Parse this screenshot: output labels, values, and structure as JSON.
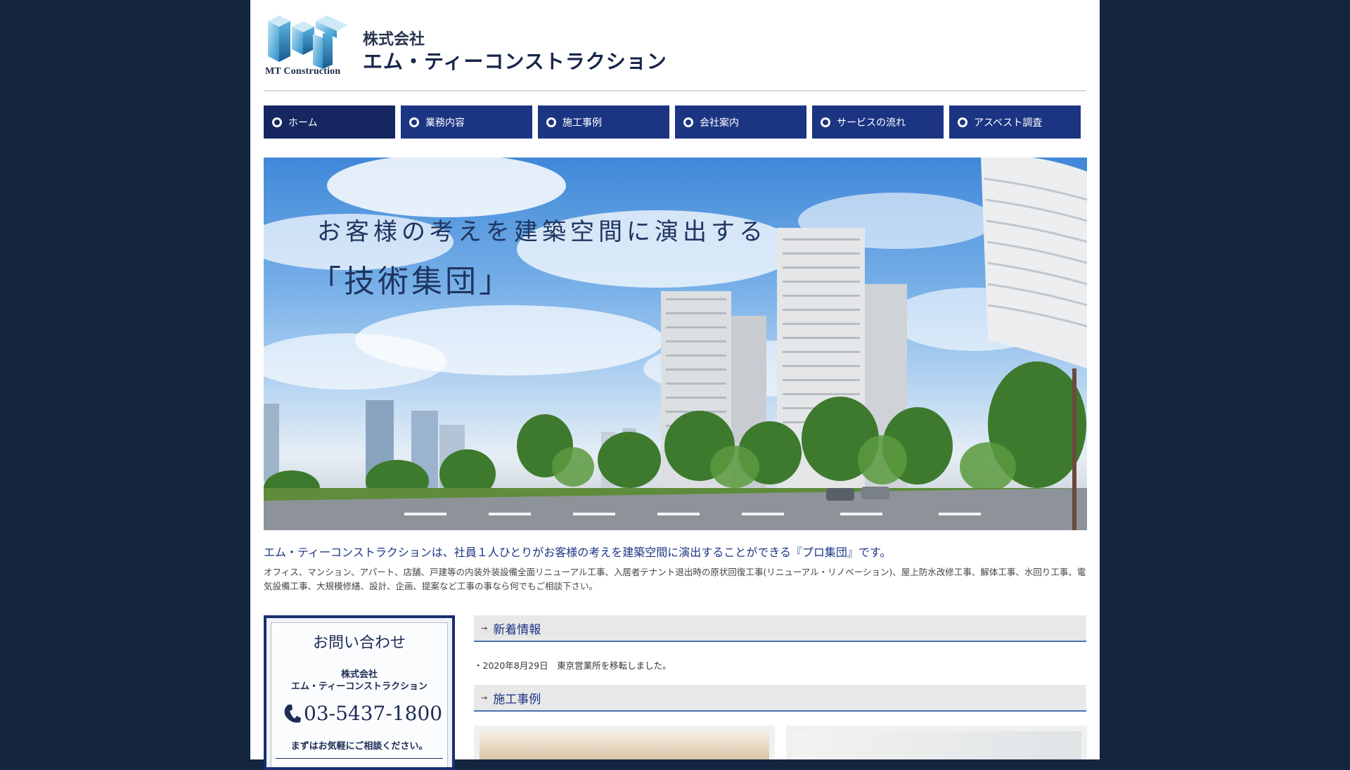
{
  "header": {
    "logo_text": "MT Construction",
    "company_prefix": "株式会社",
    "company_name": "エム・ティーコンストラクション"
  },
  "nav": {
    "items": [
      {
        "label": "ホーム",
        "active": true
      },
      {
        "label": "業務内容"
      },
      {
        "label": "施工事例"
      },
      {
        "label": "会社案内"
      },
      {
        "label": "サービスの流れ"
      },
      {
        "label": "アスベスト調査"
      }
    ]
  },
  "hero": {
    "line1": "お客様の考えを建築空間に演出する",
    "line2": "「技術集団」"
  },
  "intro": {
    "lead": "エム・ティーコンストラクションは、社員１人ひとりがお客様の考えを建築空間に演出することができる『プロ集団』です。",
    "body": "オフィス、マンション、アパート、店舗、戸建等の内装外装設備全面リニューアル工事、入居者テナント退出時の原状回復工事(リニューアル・リノベーション)、屋上防水改修工事、解体工事、水回り工事、電気設備工事、大規模修繕、設計、企画、提案など工事の事なら何でもご相談下さい。"
  },
  "contact": {
    "title": "お問い合わせ",
    "company_prefix": "株式会社",
    "company_name": "エム・ティーコンストラクション",
    "phone": "03-5437-1800",
    "note": "まずはお気軽にご相談ください。"
  },
  "news": {
    "heading": "新着情報",
    "items": [
      "・2020年8月29日　東京営業所を移転しました。"
    ]
  },
  "works": {
    "heading": "施工事例"
  },
  "colors": {
    "background": "#152540",
    "nav": "#1c3583",
    "accent_text": "#1c3583"
  }
}
